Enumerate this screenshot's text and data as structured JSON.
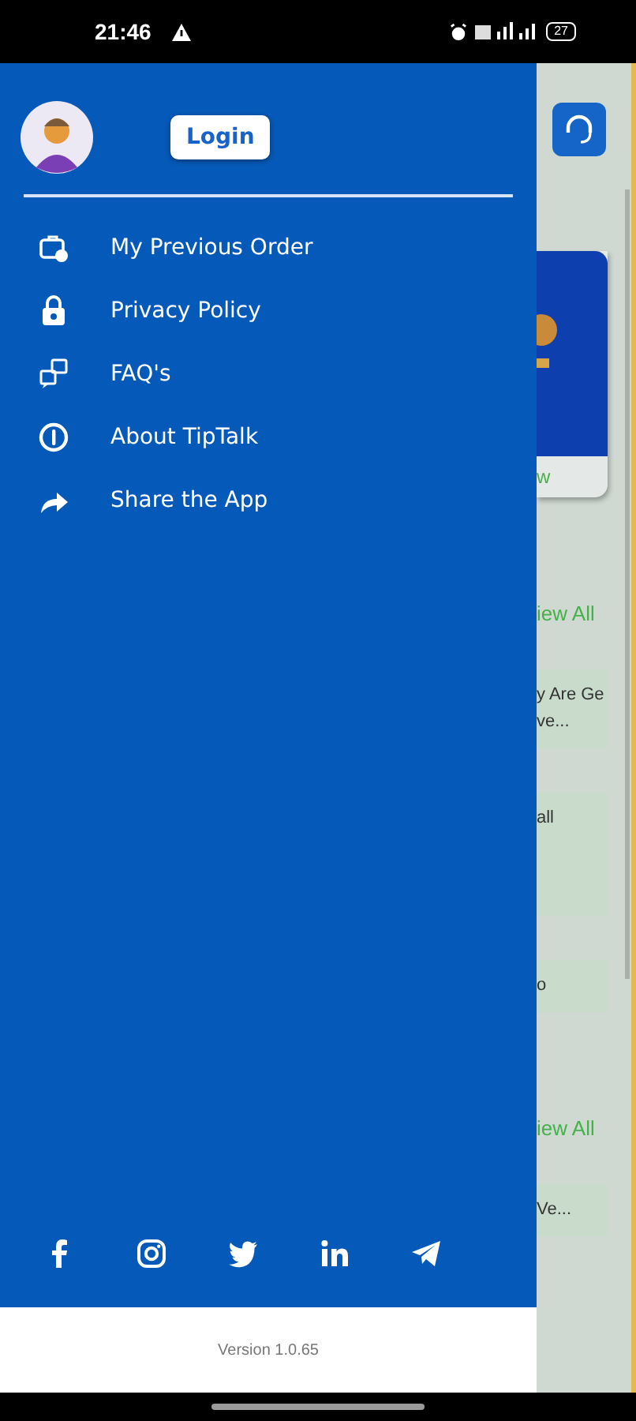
{
  "status_bar": {
    "time": "21:46",
    "battery": "27"
  },
  "drawer": {
    "login_button": "Login",
    "menu": [
      {
        "label": "My Previous Order",
        "kind": "bag"
      },
      {
        "label": "Privacy Policy",
        "kind": "lock"
      },
      {
        "label": "FAQ's",
        "kind": "faq"
      },
      {
        "label": "About TipTalk",
        "kind": "info"
      },
      {
        "label": "Share the App",
        "kind": "share"
      }
    ],
    "social": [
      {
        "kind": "facebook"
      },
      {
        "kind": "instagram"
      },
      {
        "kind": "twitter"
      },
      {
        "kind": "linkedin"
      },
      {
        "kind": "telegram"
      }
    ],
    "version": "Version 1.0.65"
  },
  "background": [
    {
      "kind": "support"
    },
    {
      "kind": "banner",
      "text": "w"
    },
    {
      "kind": "link",
      "text": "iew All"
    },
    {
      "kind": "card",
      "lines": [
        "y Are Ge",
        "ve..."
      ]
    },
    {
      "kind": "card",
      "lines": [
        "all"
      ]
    },
    {
      "kind": "card",
      "lines": [
        "o"
      ]
    },
    {
      "kind": "link",
      "text": "iew All"
    },
    {
      "kind": "card",
      "lines": [
        "Ve..."
      ]
    }
  ]
}
